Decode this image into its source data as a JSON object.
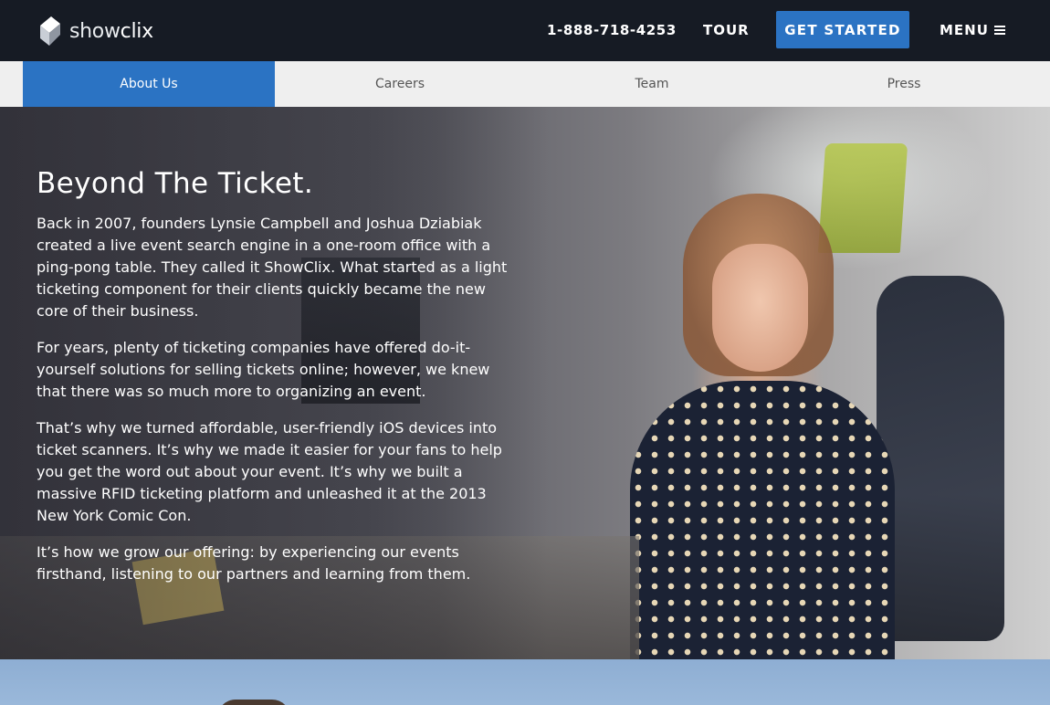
{
  "header": {
    "logo_text_light": "show",
    "logo_text_bold": "clix",
    "phone": "1-888-718-4253",
    "tour_label": "TOUR",
    "get_started_label": "GET STARTED",
    "menu_label": "MENU"
  },
  "subnav": {
    "tabs": [
      {
        "label": "About Us",
        "active": true
      },
      {
        "label": "Careers",
        "active": false
      },
      {
        "label": "Team",
        "active": false
      },
      {
        "label": "Press",
        "active": false
      }
    ]
  },
  "hero": {
    "title": "Beyond The Ticket.",
    "paragraphs": [
      "Back in 2007, founders Lynsie Campbell and Joshua Dziabiak created a live event search engine in a one-room office with a ping-pong table. They called it ShowClix. What started as a light ticketing component for their clients quickly became the new core of their business.",
      "For years, plenty of ticketing companies have offered do-it-yourself solutions for selling tickets online; however, we knew that there was so much more to organizing an event.",
      "That’s why we turned affordable, user-friendly iOS devices into ticket scanners. It’s why we made it easier for your fans to help you get the word out about your event. It’s why we built a massive RFID ticketing platform and unleashed it at the 2013 New York Comic Con.",
      "It’s how we grow our offering: by experiencing our events firsthand, listening to our partners and learning from them."
    ]
  },
  "colors": {
    "topbar_bg": "#161b24",
    "accent_blue": "#2b73c3",
    "subnav_bg": "#efefef"
  },
  "icons": {
    "logo": "showclix-logo-icon",
    "menu": "hamburger-icon"
  }
}
